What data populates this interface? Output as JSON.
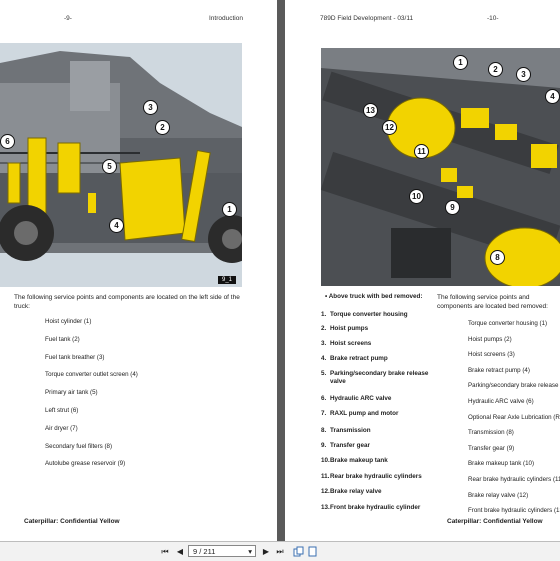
{
  "left_page": {
    "header_page_num": "-9-",
    "header_section": "Introduction",
    "figure_tag": "9_1",
    "callouts": [
      "6",
      "3",
      "2",
      "5",
      "4",
      "1"
    ],
    "intro_text": "The following service points and components are located on the left side of the truck:",
    "items": [
      "Hoist cylinder (1)",
      "Fuel tank (2)",
      "Fuel tank breather (3)",
      "Torque converter outlet screen (4)",
      "Primary air tank (5)",
      "Left strut (6)",
      "Air dryer (7)",
      "Secondary fuel filters (8)",
      "Autolube grease reservoir (9)"
    ],
    "footer": "Caterpillar: Confidential Yellow"
  },
  "right_page": {
    "header_title": "789D Field Development - 03/11",
    "header_page_num": "-10-",
    "callouts": [
      "1",
      "2",
      "3",
      "4",
      "13",
      "12",
      "11",
      "10",
      "9",
      "8"
    ],
    "list_heading": "Above truck with bed removed:",
    "numbered_items": [
      {
        "num": "1.",
        "text": "Torque converter housing"
      },
      {
        "num": "2.",
        "text": "Hoist pumps"
      },
      {
        "num": "3.",
        "text": "Hoist screens"
      },
      {
        "num": "4.",
        "text": "Brake retract pump"
      },
      {
        "num": "5.",
        "text": "Parking/secondary brake release valve"
      },
      {
        "num": "6.",
        "text": "Hydraulic ARC valve"
      },
      {
        "num": "7.",
        "text": "RAXL pump and motor"
      },
      {
        "num": "8.",
        "text": "Transmission"
      },
      {
        "num": "9.",
        "text": "Transfer gear"
      },
      {
        "num": "10.",
        "text": "Brake makeup tank"
      },
      {
        "num": "11.",
        "text": "Rear brake hydraulic cylinders"
      },
      {
        "num": "12.",
        "text": "Brake relay valve"
      },
      {
        "num": "13.",
        "text": "Front brake hydraulic cylinder"
      }
    ],
    "intro_text": "The following service points and components are located bed removed:",
    "items": [
      "Torque converter housing (1)",
      "Hoist pumps (2)",
      "Hoist screens (3)",
      "Brake retract pump (4)",
      "Parking/secondary brake release",
      "Hydraulic ARC valve (6)",
      "Optional Rear Axle Lubrication (RA",
      "Transmission (8)",
      "Transfer gear (9)",
      "Brake makeup tank (10)",
      "Rear brake hydraulic cylinders (11",
      "Brake relay valve (12)",
      "Front brake hydraulic cylinders (13"
    ],
    "footer": "Caterpillar: Confidential Yellow"
  },
  "toolbar": {
    "page_input": "9 / 211",
    "first_icon": "⏮",
    "prev_icon": "◀",
    "next_icon": "▶",
    "last_icon": "⏭",
    "dropdown_icon": "▾"
  },
  "colors": {
    "background": "#5a5a5a",
    "component_yellow": "#f2d300",
    "machine_gray": "#6f7378"
  }
}
